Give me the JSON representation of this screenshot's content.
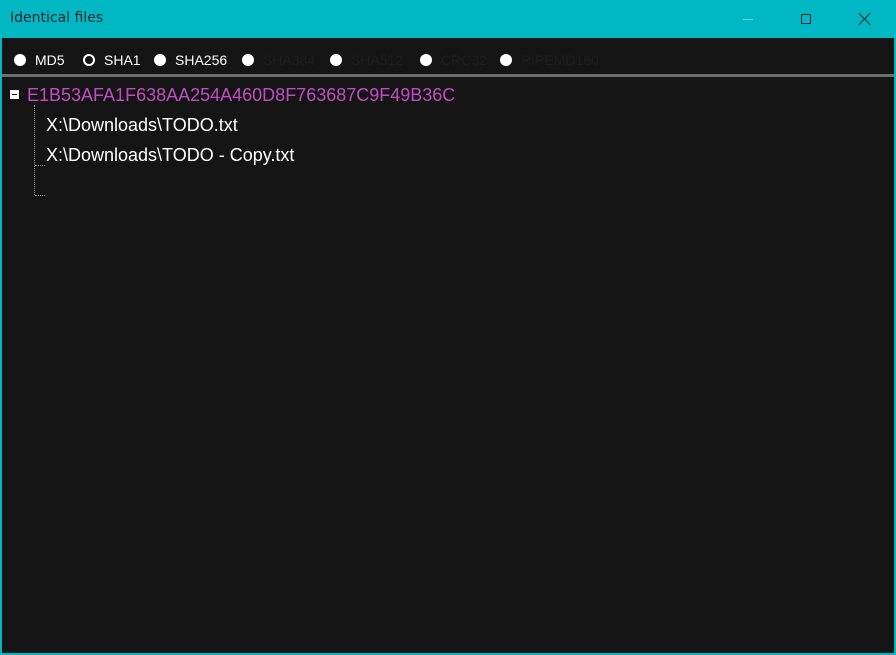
{
  "window": {
    "title": "Identical files",
    "accent": "#00b7c3"
  },
  "hash_options": [
    {
      "label": "MD5",
      "selected": false,
      "enabled": true
    },
    {
      "label": "SHA1",
      "selected": true,
      "enabled": true
    },
    {
      "label": "SHA256",
      "selected": false,
      "enabled": true
    },
    {
      "label": "SHA384",
      "selected": false,
      "enabled": false
    },
    {
      "label": "SHA512",
      "selected": false,
      "enabled": false
    },
    {
      "label": "CRC32",
      "selected": false,
      "enabled": false
    },
    {
      "label": "RIPEMD160",
      "selected": false,
      "enabled": false
    }
  ],
  "tree": {
    "root": {
      "label": "E1B53AFA1F638AA254A460D8F763687C9F49B36C",
      "expanded": true,
      "color": "#c04dc4",
      "children": [
        {
          "label": "X:\\Downloads\\TODO.txt"
        },
        {
          "label": "X:\\Downloads\\TODO - Copy.txt"
        }
      ]
    }
  },
  "icons": {
    "minimize": "minimize-icon",
    "maximize": "maximize-icon",
    "close": "close-icon",
    "collapse": "collapse-minus-icon"
  }
}
